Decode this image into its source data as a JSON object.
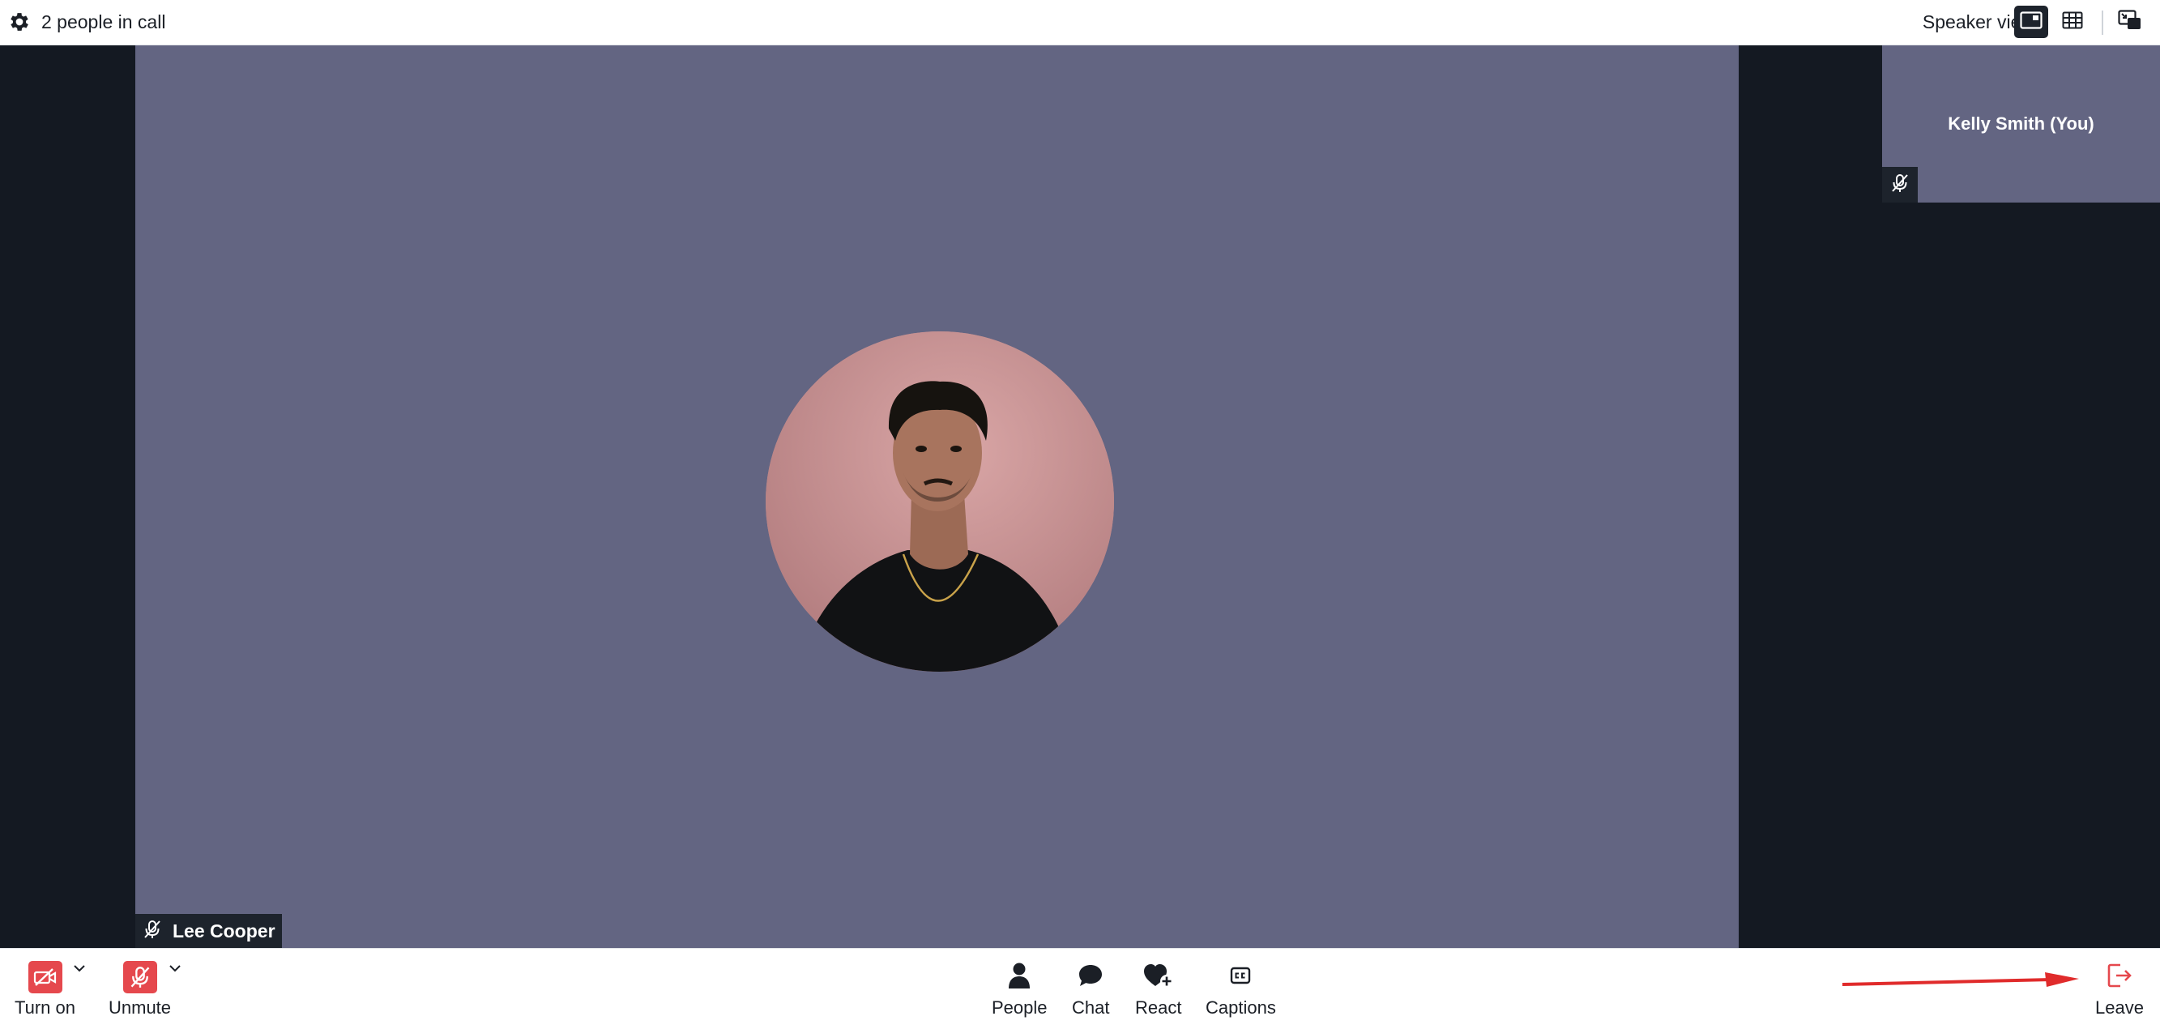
{
  "header": {
    "call_count": "2 people in call",
    "view_label": "Speaker view",
    "icons": {
      "settings": "gear-icon",
      "speaker": "speaker-view-icon",
      "grid": "grid-view-icon",
      "pip": "picture-in-picture-icon"
    }
  },
  "stage": {
    "main_participant": {
      "name": "Lee Cooper",
      "muted": true
    },
    "self_participant": {
      "name": "Kelly Smith (You)",
      "muted": true
    }
  },
  "controls": {
    "camera": {
      "label": "Turn on",
      "icon": "video-off-icon"
    },
    "microphone": {
      "label": "Unmute",
      "icon": "mic-off-icon"
    },
    "people": {
      "label": "People",
      "icon": "person-icon"
    },
    "chat": {
      "label": "Chat",
      "icon": "chat-bubble-icon"
    },
    "react": {
      "label": "React",
      "icon": "heart-plus-icon"
    },
    "captions": {
      "label": "Captions",
      "icon": "cc-icon"
    },
    "leave": {
      "label": "Leave",
      "icon": "leave-icon"
    }
  },
  "colors": {
    "stage_bg": "#141922",
    "tile_bg": "#636582",
    "danger": "#e5484d",
    "annotation_arrow": "#e02b2b",
    "dark_chip": "#1d232c"
  }
}
